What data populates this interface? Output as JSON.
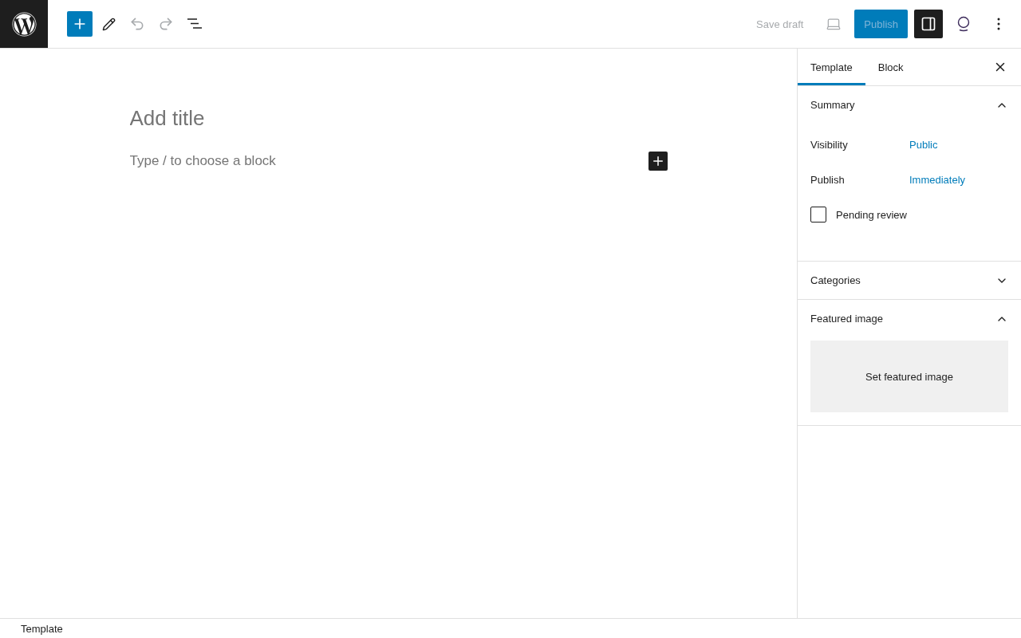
{
  "toolbar": {
    "left": [
      {
        "kind": "add",
        "disabled": false
      },
      {
        "kind": "edit",
        "disabled": false
      },
      {
        "kind": "undo",
        "disabled": true
      },
      {
        "kind": "redo",
        "disabled": true
      },
      {
        "kind": "list",
        "disabled": false
      }
    ],
    "save_draft": {
      "label": "Save draft",
      "disabled": true
    },
    "preview": {
      "disabled": true
    },
    "publish": {
      "label": "Publish",
      "disabled": true
    },
    "settings": {
      "pressed": true
    }
  },
  "editor": {
    "title_placeholder": "Add title",
    "block_placeholder": "Type / to choose a block"
  },
  "sidebar": {
    "tabs": [
      {
        "label": "Template",
        "selected": true
      },
      {
        "label": "Block",
        "selected": false
      }
    ],
    "panels": [
      {
        "kind": "summary",
        "title": "Summary",
        "expanded": true,
        "rows": [
          {
            "label": "Visibility",
            "value": "Public"
          },
          {
            "label": "Publish",
            "value": "Immediately"
          }
        ],
        "checkbox": {
          "label": "Pending review",
          "checked": false
        }
      },
      {
        "kind": "categories",
        "title": "Categories",
        "expanded": false
      },
      {
        "kind": "featured",
        "title": "Featured image",
        "expanded": true,
        "button": "Set featured image"
      }
    ]
  },
  "footer": {
    "breadcrumb": "Template"
  }
}
